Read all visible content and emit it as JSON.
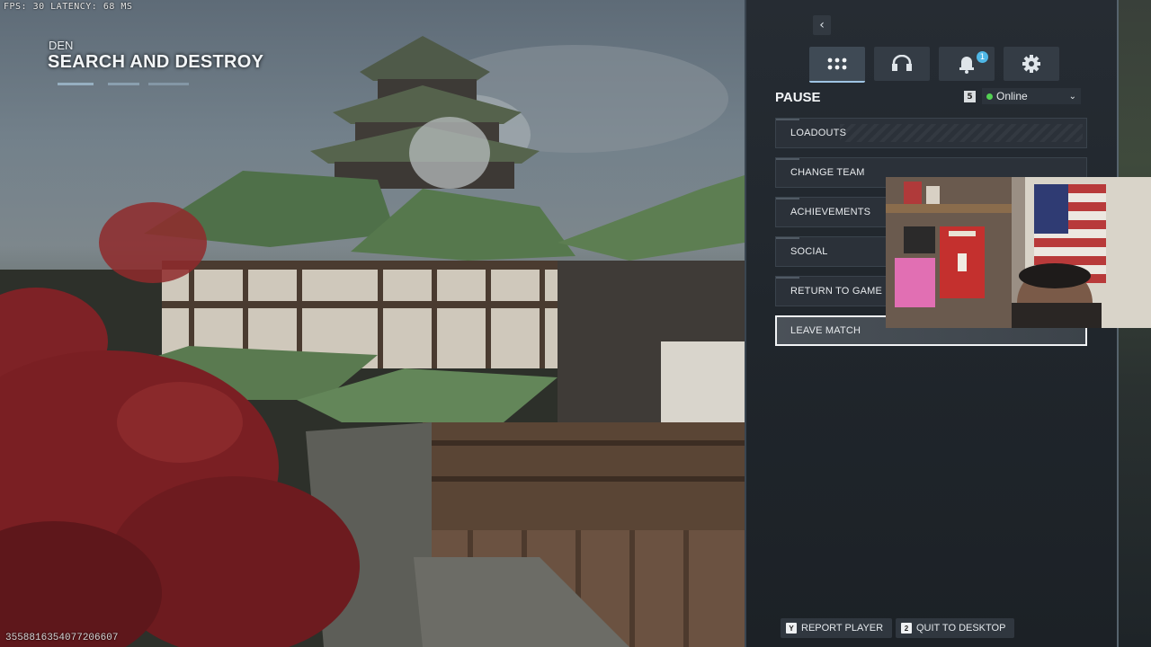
{
  "hud": {
    "fps_text": "FPS:  30  LATENCY: 68 MS",
    "map_name": "DEN",
    "game_mode": "SEARCH AND DESTROY",
    "session_id": "3558816354077206607"
  },
  "pause_menu": {
    "title": "PAUSE",
    "party_count": "5",
    "status_label": "Online",
    "status_color": "#53d153",
    "tabs": [
      {
        "icon": "grid-icon",
        "active": true
      },
      {
        "icon": "headset-icon",
        "active": false
      },
      {
        "icon": "bell-icon",
        "active": false,
        "badge": "1"
      },
      {
        "icon": "gear-icon",
        "active": false
      }
    ],
    "items": [
      {
        "label": "LOADOUTS"
      },
      {
        "label": "CHANGE TEAM"
      },
      {
        "label": "ACHIEVEMENTS"
      },
      {
        "label": "SOCIAL"
      },
      {
        "label": "RETURN TO GAME"
      },
      {
        "label": "LEAVE MATCH",
        "selected": true
      }
    ]
  },
  "footer": {
    "report_key": "Y",
    "report_label": "REPORT PLAYER",
    "quit_key": "2",
    "quit_label": "QUIT TO DESKTOP"
  },
  "colors": {
    "panel_bg": "#22282e",
    "tab_active_underline": "#9fc4e4",
    "badge": "#4fb7e6",
    "selected_border": "#f1f3f5"
  }
}
